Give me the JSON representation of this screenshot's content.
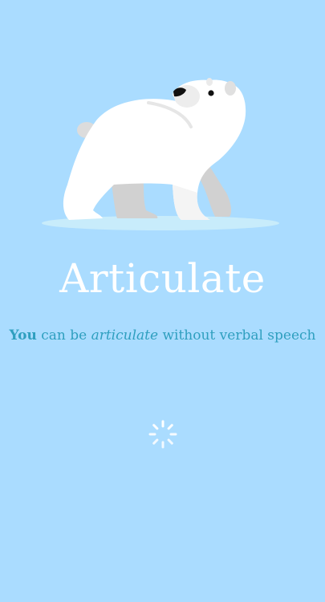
{
  "app": {
    "title": "Articulate",
    "tagline": {
      "part1": "You",
      "part2": " can be ",
      "part3": "articulate",
      "part4": " without verbal speech"
    }
  },
  "illustration": {
    "icon": "polar-bear-icon"
  },
  "loading": {
    "icon": "loading-spinner-icon"
  },
  "colors": {
    "background": "#aadcff",
    "title": "#ffffff",
    "tagline": "#2f9fbf"
  }
}
